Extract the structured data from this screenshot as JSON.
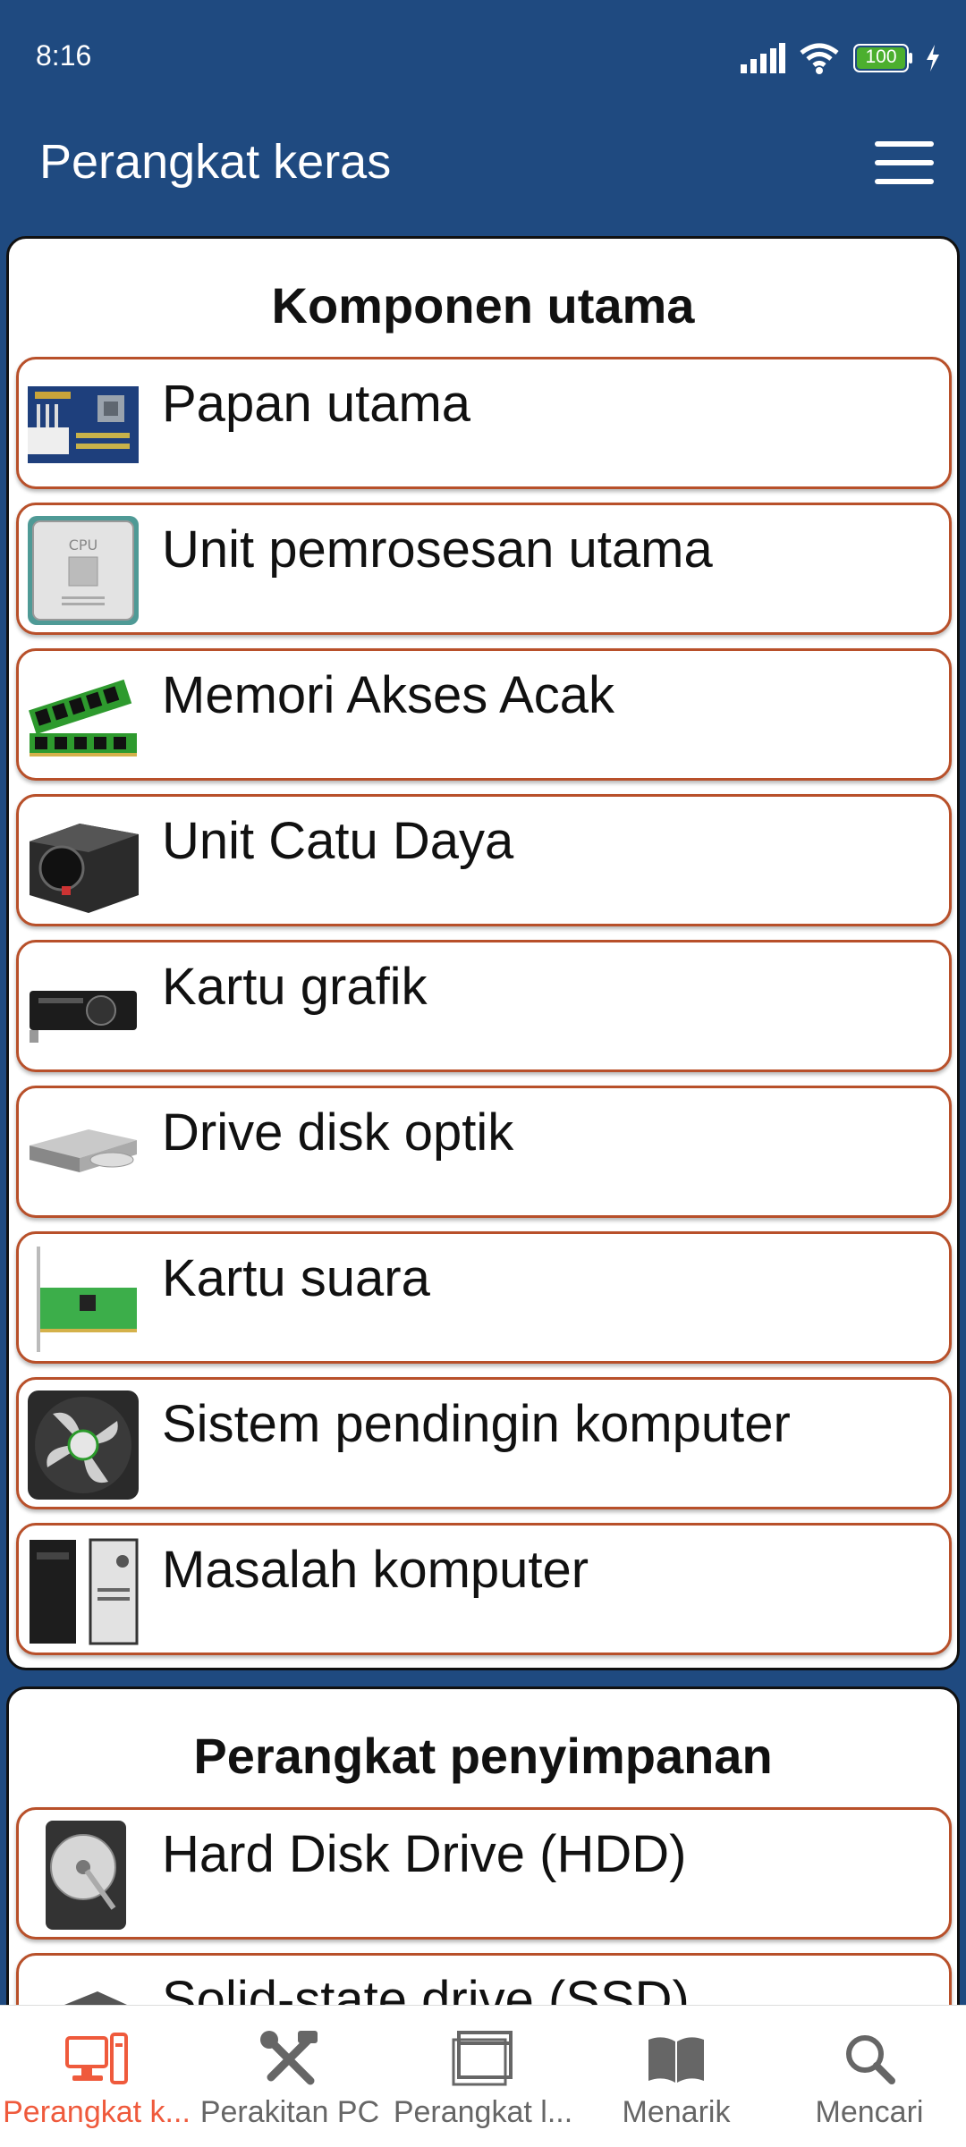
{
  "status_bar": {
    "time": "8:16",
    "battery": "100"
  },
  "app_bar": {
    "title": "Perangkat keras"
  },
  "sections": [
    {
      "title": "Komponen utama",
      "items": [
        {
          "label": "Papan utama",
          "icon": "motherboard-icon"
        },
        {
          "label": "Unit pemrosesan utama",
          "icon": "cpu-icon"
        },
        {
          "label": "Memori Akses Acak",
          "icon": "ram-icon"
        },
        {
          "label": "Unit Catu Daya",
          "icon": "power-supply-icon"
        },
        {
          "label": "Kartu grafik",
          "icon": "graphics-card-icon"
        },
        {
          "label": "Drive disk optik",
          "icon": "optical-drive-icon"
        },
        {
          "label": "Kartu suara",
          "icon": "sound-card-icon"
        },
        {
          "label": "Sistem pendingin komputer",
          "icon": "cooling-fan-icon"
        },
        {
          "label": "Masalah komputer",
          "icon": "computer-case-icon"
        }
      ]
    },
    {
      "title": "Perangkat penyimpanan",
      "items": [
        {
          "label": "Hard Disk Drive (HDD)",
          "icon": "hdd-icon"
        },
        {
          "label": "Solid-state drive (SSD)",
          "icon": "ssd-icon"
        }
      ]
    }
  ],
  "bottom_nav": [
    {
      "label": "Perangkat k...",
      "icon": "computer-icon",
      "active": true
    },
    {
      "label": "Perakitan PC",
      "icon": "tools-icon",
      "active": false
    },
    {
      "label": "Perangkat l...",
      "icon": "window-icon",
      "active": false
    },
    {
      "label": "Menarik",
      "icon": "book-icon",
      "active": false
    },
    {
      "label": "Mencari",
      "icon": "search-icon",
      "active": false
    }
  ],
  "colors": {
    "primary": "#1f4a80",
    "item_border": "#b8502a",
    "nav_active": "#ef5a3c"
  }
}
